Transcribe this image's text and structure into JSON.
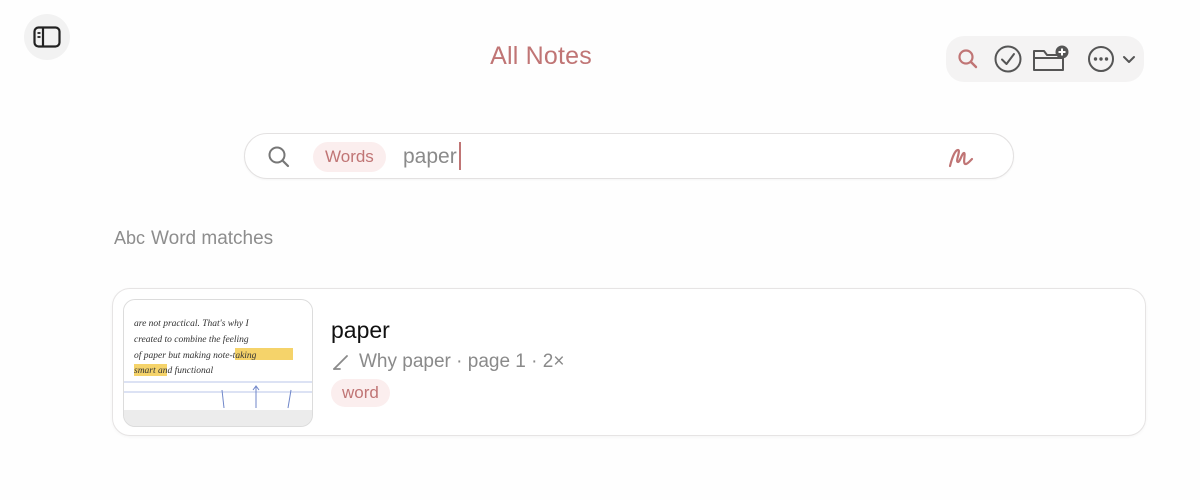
{
  "header": {
    "title": "All Notes",
    "sidebar_toggle_icon": "sidebar-icon",
    "toolbar": {
      "icons": [
        "search-icon",
        "select-check-icon",
        "new-folder-icon",
        "more-icon",
        "chevron-down-icon"
      ]
    }
  },
  "search": {
    "filter_chip": "Words",
    "query": "paper",
    "icon": "search-icon",
    "handwriting_icon": "handwriting-icon"
  },
  "results": {
    "section_prefix": "Abc",
    "section_title": "Word matches",
    "items": [
      {
        "title": "paper",
        "meta": "Why paper · page 1 · 2×",
        "tag": "word",
        "thumbnail_lines": [
          "are not practical. That's why I",
          "created to combine the feeling",
          "of paper but making note-taking",
          "smart and functional"
        ]
      }
    ]
  },
  "colors": {
    "accent": "#c07575",
    "chip_bg": "#fbeeee",
    "highlight": "#f5d36a"
  }
}
